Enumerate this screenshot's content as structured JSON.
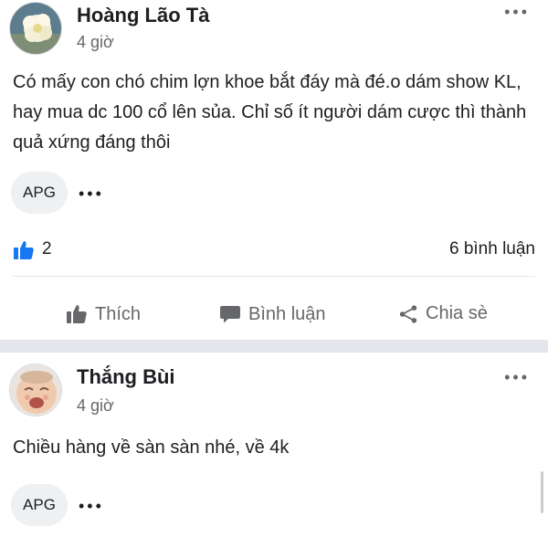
{
  "posts": [
    {
      "author": "Hoàng Lão Tà",
      "time": "4 giờ",
      "text": "Có mấy con chó chim lợn khoe bắt đáy mà đé.o dám show KL, hay mua dc 100 cổ lên sủa. Chỉ số ít người dám cược thì thành quả xứng đáng thôi",
      "chip_label": "APG",
      "like_count": "2",
      "comment_count": "6 bình luận",
      "actions": {
        "like": "Thích",
        "comment": "Bình luận",
        "share": "Chia sè"
      }
    },
    {
      "author": "Thắng Bùi",
      "time": "4 giờ",
      "text": "Chiều hàng về sàn sàn nhé, về 4k",
      "chip_label": "APG"
    }
  ],
  "icons": {
    "more": "more-horizontal-icon",
    "like_reaction": "thumbs-up-icon",
    "comment": "speech-bubble-icon",
    "share": "share-icon"
  },
  "colors": {
    "like_blue": "#1877f2",
    "secondary_text": "#65676b",
    "chip_bg": "#eff0f2",
    "separator": "#e4e6eb"
  }
}
